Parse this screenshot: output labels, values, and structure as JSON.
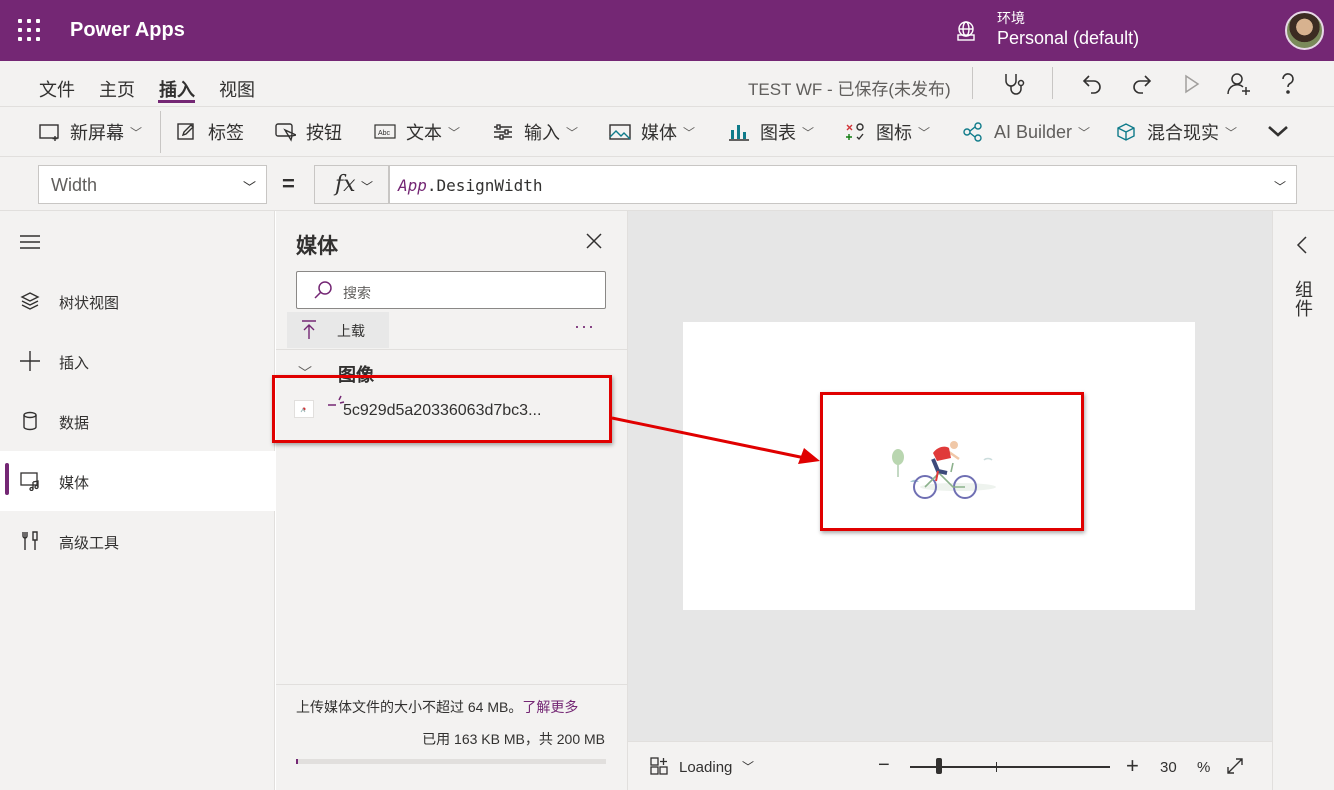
{
  "topbar": {
    "app_title": "Power Apps",
    "env_label": "环境",
    "env_value": "Personal (default)"
  },
  "menu": {
    "file": "文件",
    "home": "主页",
    "insert": "插入",
    "view": "视图",
    "doc_status": "TEST WF - 已保存(未发布)"
  },
  "ribbon": {
    "new_screen": "新屏幕",
    "label": "标签",
    "button": "按钮",
    "text": "文本",
    "input": "输入",
    "media": "媒体",
    "chart": "图表",
    "icons": "图标",
    "ai_builder": "AI Builder",
    "mixed_reality": "混合现实"
  },
  "formula": {
    "property": "Width",
    "equals": "=",
    "fx": "fx",
    "object": "App",
    "member": ".DesignWidth"
  },
  "leftnav": {
    "items": [
      {
        "label": "树状视图"
      },
      {
        "label": "插入"
      },
      {
        "label": "数据"
      },
      {
        "label": "媒体"
      },
      {
        "label": "高级工具"
      }
    ]
  },
  "media_panel": {
    "title": "媒体",
    "search_placeholder": "搜索",
    "upload": "上载",
    "more": "···",
    "group_title": "图像",
    "file_name": "5c929d5a20336063d7bc3...",
    "upload_note": "上传媒体文件的大小不超过 64 MB。",
    "learn_more": "了解更多",
    "usage_text": "已用 163 KB MB，共 200 MB",
    "usage_fraction": 0.0008
  },
  "status": {
    "loading": "Loading",
    "zoom_minus": "−",
    "zoom_plus": "+",
    "zoom_value": "30",
    "zoom_unit": "%",
    "zoom_level": 0.3
  },
  "rightrail": {
    "label": "组件"
  },
  "colors": {
    "brand": "#742774",
    "annotation": "#e00000"
  }
}
